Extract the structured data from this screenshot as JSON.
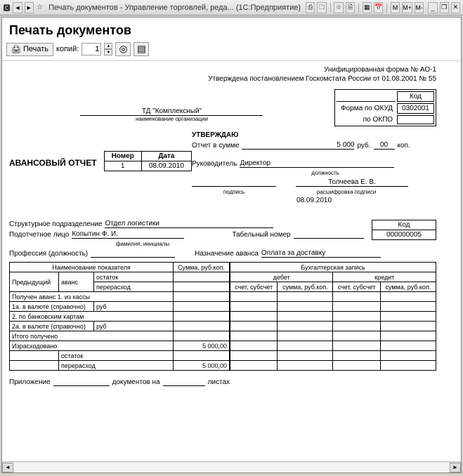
{
  "titlebar": {
    "app_icon": "1c",
    "back_icon": "◄",
    "fwd_icon": "►",
    "star_icon": "☆",
    "title": "Печать документов - Управление торговлей, реда...   (1С:Предприятие)",
    "m": "M",
    "mplus": "M+",
    "mminus": "M-",
    "min": "_",
    "max": "❐",
    "close": "✕"
  },
  "header": {
    "title": "Печать документов"
  },
  "toolbar": {
    "print_icon": "🖨",
    "print_label": "Печать",
    "copies_label": "копий:",
    "copies_value": "1",
    "btn_a": "◎",
    "btn_b": "▤"
  },
  "doc": {
    "form_no": "Унифицированная форма № АО-1",
    "approved": "Утверждена постановлением Госкомстата России от  01.08.2001 № 55",
    "kod_label": "Код",
    "okud_label": "Форма по ОКУД",
    "okud": "0302001",
    "okpo_label": "по ОКПО",
    "okpo": "",
    "org": "ТД \"Комплексный\"",
    "org_sub": "наименование организации",
    "approve_title": "УТВЕРЖДАЮ",
    "sum_label": "Отчет в сумме",
    "sum": "5 000",
    "rub": "руб.",
    "kop_val": "00",
    "kop": "коп.",
    "ruk_label": "Руководитель",
    "ruk_pos": "Директор",
    "pos_sub": "должность",
    "sign_sub": "подпись",
    "ruk_name": "Толчеева Е. В.",
    "name_sub": "расшифровка подписи",
    "date2": "08.09.2010",
    "avans_title": "АВАНСОВЫЙ ОТЧЕТ",
    "num_h": "Номер",
    "date_h": "Дата",
    "num": "1",
    "date": "08.09.2010",
    "kod2_label": "Код",
    "kod2": "000000005",
    "dept_label": "Структурное подразделение",
    "dept": "Отдел логистики",
    "person_label": "Подотчетное лицо",
    "person": "Копытин Ф. И.",
    "person_sub": "фамилия, инициалы",
    "tabno_label": "Табельный номер",
    "prof_label": "Профессия (должность)",
    "nazn_label": "Назначение аванса",
    "nazn": "Оплата за доставку",
    "left_h1": "Наименование показателя",
    "left_h2": "Сумма, руб.коп.",
    "prev": "Предыдущий",
    "avans": "аванс",
    "ost": "остаток",
    "pererash": "перерасход",
    "pol": "Получен аванс 1. из кассы",
    "r1a": "1а. в валюте (справочно)",
    "rub2": "руб",
    "r2": "2. по банковским картам",
    "r2a": "2а. в валюте (справочно)",
    "itogo": "Итого получено",
    "izrash": "Израсходовано",
    "izrash_v": "5 000,00",
    "ost2": "остаток",
    "perer2": "перерасход",
    "perer2_v": "5 000,00",
    "right_h": "Бухгалтерская запись",
    "debet": "дебет",
    "kredit": "кредит",
    "ssub": "счет, субсчет",
    "srk": "сумма, руб.коп.",
    "pril": "Приложение",
    "dokna": "документов на",
    "listah": "листах"
  }
}
